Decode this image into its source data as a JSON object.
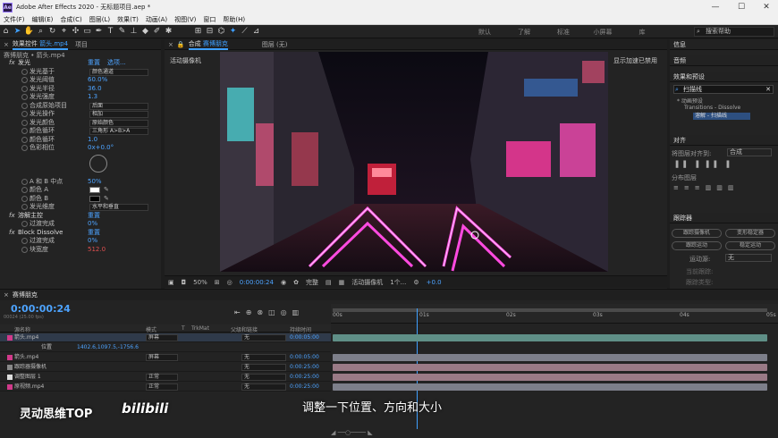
{
  "titlebar": {
    "title": "Adobe After Effects 2020 - 无标题项目.aep *",
    "minimize": "—",
    "maximize": "☐",
    "close": "✕"
  },
  "menu": [
    "文件(F)",
    "编辑(E)",
    "合成(C)",
    "图层(L)",
    "效果(T)",
    "动画(A)",
    "视图(V)",
    "窗口",
    "帮助(H)"
  ],
  "workspaces": [
    "默认",
    "了解",
    "标准",
    "小屏幕",
    "库"
  ],
  "search_help": {
    "placeholder": "搜索帮助"
  },
  "effect_controls": {
    "tab_label": "效果控件",
    "tab_target": "箭头.mp4",
    "tab_project": "项目",
    "breadcrumb": "赛博朋克 • 箭头.mp4",
    "effect1": {
      "name": "发光",
      "reset": "重置",
      "options": "选项..."
    },
    "rows": [
      {
        "name": "发光基于",
        "value": "颜色通道",
        "dropdown": true
      },
      {
        "name": "发光阈值",
        "value": "60.0%"
      },
      {
        "name": "发光半径",
        "value": "36.0"
      },
      {
        "name": "发光强度",
        "value": "1.3"
      },
      {
        "name": "合成原始项目",
        "value": "后面",
        "dropdown": true
      },
      {
        "name": "发光操作",
        "value": "相加",
        "dropdown": true
      },
      {
        "name": "发光颜色",
        "value": "原始颜色",
        "dropdown": true
      },
      {
        "name": "颜色循环",
        "value": "三角形 A>B>A",
        "dropdown": true
      },
      {
        "name": "颜色循环",
        "value": "1.0"
      },
      {
        "name": "色彩相位",
        "value": "0x+0.0°"
      },
      {
        "name": "A 和 B 中点",
        "value": "50%"
      },
      {
        "name": "颜色 A",
        "value": ""
      },
      {
        "name": "颜色 B",
        "value": ""
      },
      {
        "name": "发光维度",
        "value": "水平和垂直",
        "dropdown": true
      }
    ],
    "effect2": {
      "name": "溶解主控",
      "reset": "重置",
      "row_name": "过渡完成",
      "row_value": "0%"
    },
    "effect3": {
      "name": "Block Dissolve",
      "reset": "重置",
      "rows": [
        {
          "name": "过渡完成",
          "value": "0%"
        },
        {
          "name": "块宽度",
          "value": "512.0"
        }
      ]
    }
  },
  "composition": {
    "tab_label": "合成",
    "tab_name": "赛博朋克",
    "layer_tab": "图层 (无)",
    "active_camera": "活动摄像机",
    "render_accel": "显示加速已禁用",
    "bottom": {
      "zoom": "50%",
      "timecode": "0:00:00:24",
      "quality": "完整",
      "camera": "活动摄像机",
      "views": "1个...",
      "exposure": "+0.0"
    }
  },
  "right_panel": {
    "info": "信息",
    "audio": "音频",
    "effects_presets": "效果和预设",
    "search_value": "扫描线",
    "tree": [
      "* 动画预设",
      "Transitions - Dissolve",
      "溶解 - 扫描线"
    ],
    "align": "对齐",
    "align_to_label": "将图层对齐到:",
    "align_to_value": "合成",
    "distribute": "分布图层",
    "tracker": "跟踪器",
    "tracker_buttons": [
      "跟踪摄像机",
      "变形稳定器",
      "跟踪运动",
      "稳定运动"
    ],
    "motion_source_label": "运动源:",
    "motion_source_value": "无",
    "current_track_label": "当前跟踪:",
    "track_type_label": "跟踪类型:"
  },
  "timeline": {
    "comp_name": "赛博朋克",
    "timecode": "0:00:00:24",
    "fps": "00024 (25.00 fps)",
    "columns": {
      "source": "源名称",
      "mode": "模式",
      "t": "T",
      "trkmat": "TrkMat",
      "parent": "父级和链接",
      "duration": "持续时间"
    },
    "layers": [
      {
        "num": "1",
        "name": "箭头.mp4",
        "mode": "屏幕",
        "parent": "无",
        "duration": "0:00:05:00"
      },
      {
        "num": "",
        "name": "位置",
        "value": "1402.6,1097.5,-1756.6",
        "mode": "",
        "parent": "",
        "duration": ""
      },
      {
        "num": "2",
        "name": "箭头.mp4",
        "mode": "屏幕",
        "parent": "无",
        "duration": "0:00:05:00"
      },
      {
        "num": "3",
        "name": "跟踪器摄像机",
        "mode": "",
        "parent": "无",
        "duration": "0:00:25:00"
      },
      {
        "num": "4",
        "name": "调整图层 1",
        "mode": "正常",
        "parent": "无",
        "duration": "0:00:25:00"
      },
      {
        "num": "5",
        "name": "原视频.mp4",
        "mode": "正常",
        "parent": "无",
        "duration": "0:00:25:00"
      }
    ],
    "ruler": [
      "00s",
      "01s",
      "02s",
      "03s",
      "04s",
      "05s"
    ],
    "colors": {
      "bar_teal": "#5f8f87",
      "bar_pink": "#9a7a86",
      "bar_gray": "#7d7f8a"
    }
  },
  "overlay": {
    "subtitle": "调整一下位置、方向和大小",
    "watermark": "灵动思维TOP",
    "watermark_logo": "bilibili"
  }
}
